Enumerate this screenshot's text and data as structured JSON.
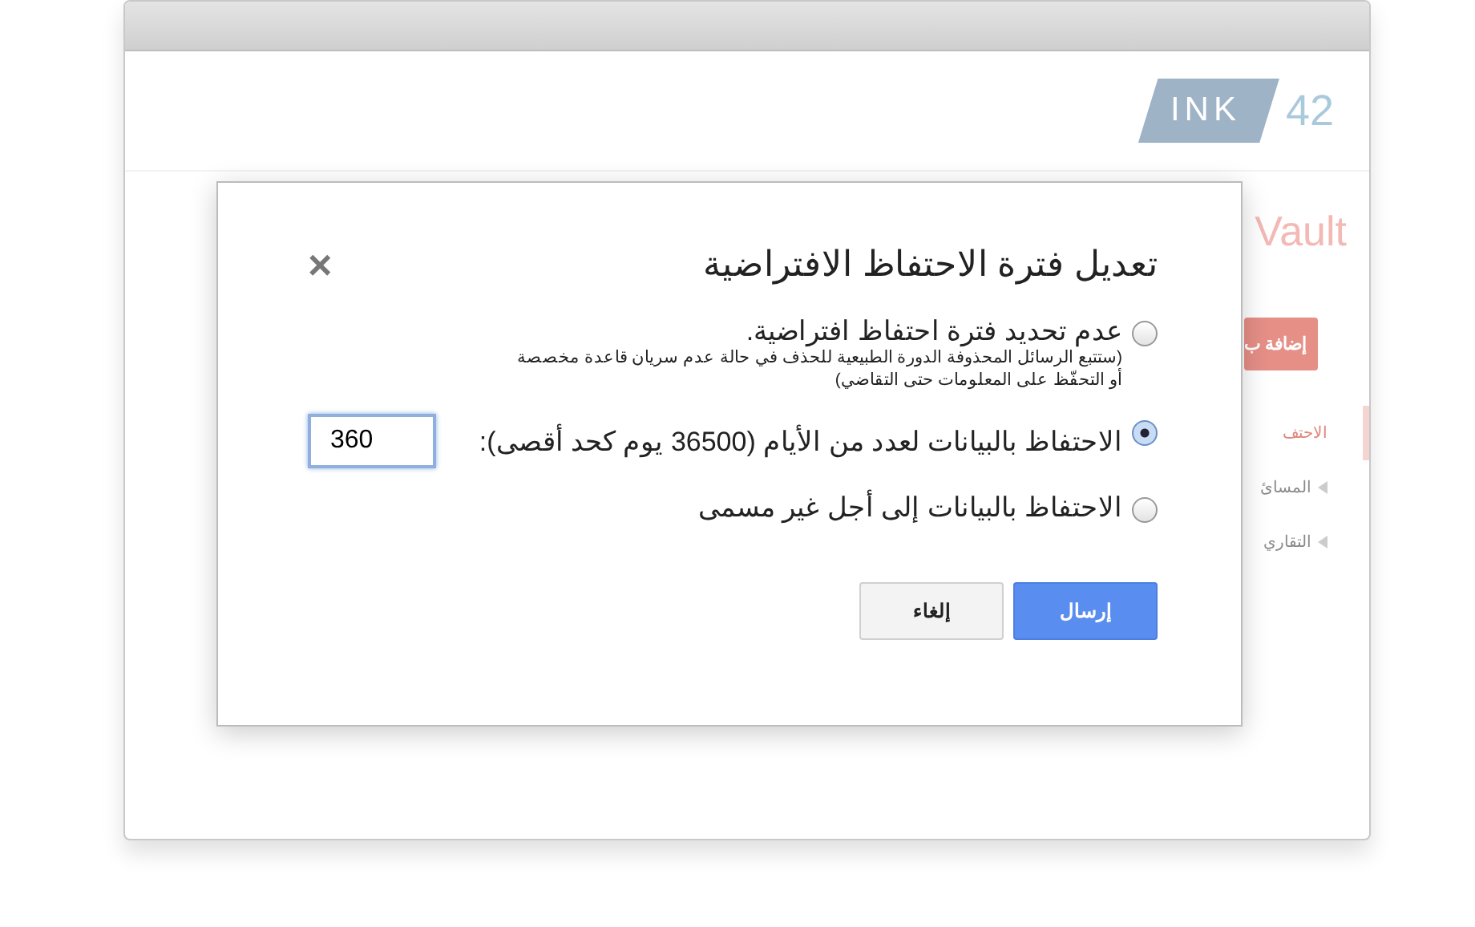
{
  "logo": {
    "badge": "INK",
    "number": "42"
  },
  "page": {
    "title": "Vault",
    "add_button": "إضافة ب",
    "sidebar": [
      {
        "label": "الاحتف",
        "selected": true
      },
      {
        "label": "المسائ",
        "selected": false
      },
      {
        "label": "التقاري",
        "selected": false
      }
    ]
  },
  "dialog": {
    "title": "تعديل فترة الاحتفاظ الافتراضية",
    "close": "×",
    "options": [
      {
        "kind": "plain",
        "label": "عدم تحديد فترة احتفاظ افتراضية.",
        "note": "(ستتبع الرسائل المحذوفة الدورة الطبيعية للحذف في حالة عدم سريان قاعدة مخصصة أو التحفّظ على المعلومات حتى التقاضي)",
        "selected": false
      },
      {
        "kind": "days",
        "label": "الاحتفاظ بالبيانات لعدد من الأيام (36500 يوم كحد أقصى):",
        "value": "360",
        "selected": true
      },
      {
        "kind": "plain",
        "label": "الاحتفاظ بالبيانات إلى أجل غير مسمى",
        "selected": false
      }
    ],
    "buttons": [
      {
        "label": "إرسال",
        "kind": "primary"
      },
      {
        "label": "إلغاء",
        "kind": "secondary"
      }
    ]
  }
}
